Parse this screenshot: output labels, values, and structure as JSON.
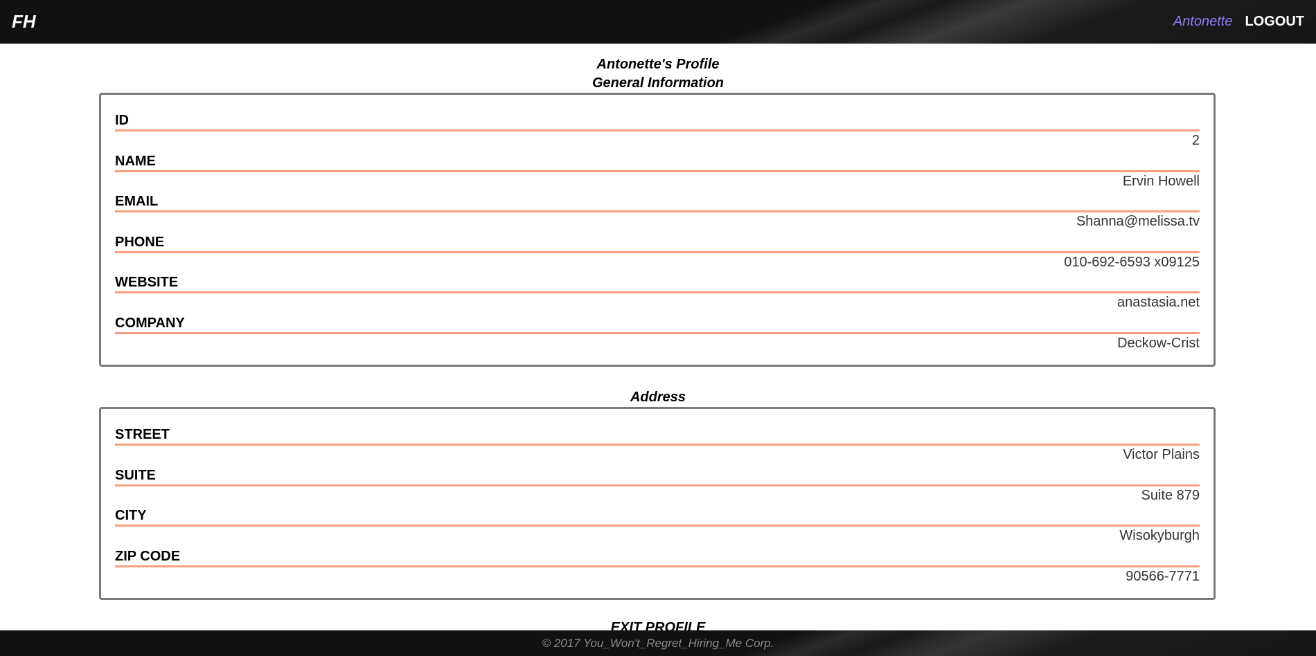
{
  "header": {
    "logo": "FH",
    "user": "Antonette",
    "logout": "LOGOUT"
  },
  "profile": {
    "title": "Antonette's Profile",
    "general_heading": "General Information",
    "general_fields": [
      {
        "label": "ID",
        "value": "2"
      },
      {
        "label": "NAME",
        "value": "Ervin Howell"
      },
      {
        "label": "EMAIL",
        "value": "Shanna@melissa.tv"
      },
      {
        "label": "PHONE",
        "value": "010-692-6593 x09125"
      },
      {
        "label": "WEBSITE",
        "value": "anastasia.net"
      },
      {
        "label": "COMPANY",
        "value": "Deckow-Crist"
      }
    ],
    "address_heading": "Address",
    "address_fields": [
      {
        "label": "STREET",
        "value": "Victor Plains"
      },
      {
        "label": "SUITE",
        "value": "Suite 879"
      },
      {
        "label": "CITY",
        "value": "Wisokyburgh"
      },
      {
        "label": "ZIP CODE",
        "value": "90566-7771"
      }
    ],
    "exit": "EXIT PROFILE"
  },
  "footer": {
    "copyright": "© 2017 You_Won't_Regret_Hiring_Me Corp."
  },
  "colors": {
    "accent_line": "#f4a07e",
    "user_link": "#8a7cff",
    "bar_bg": "#111111"
  }
}
